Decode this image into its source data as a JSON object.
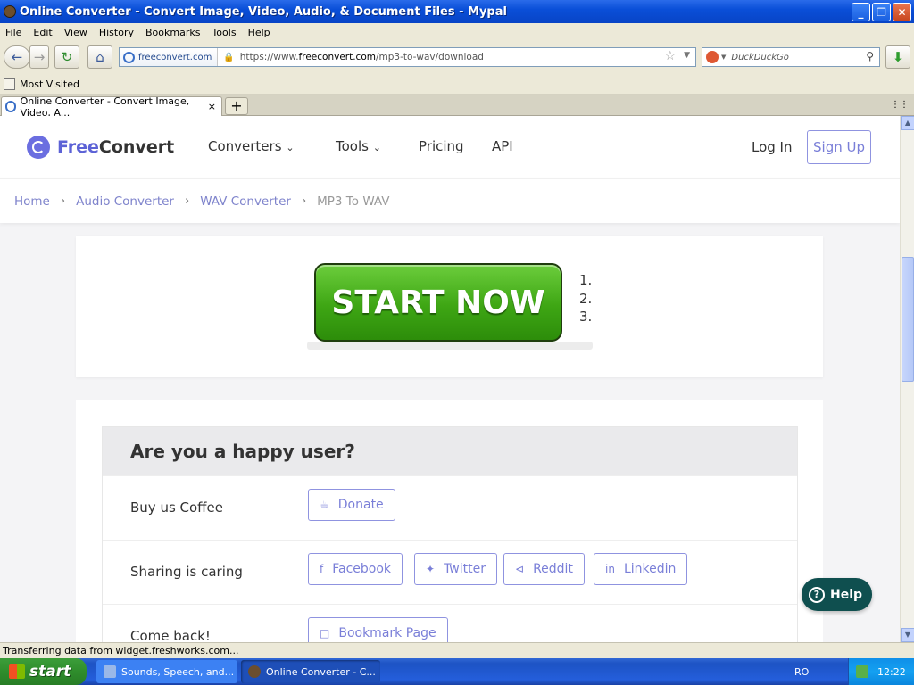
{
  "window": {
    "title": "Online Converter - Convert Image, Video, Audio, & Document Files - Mypal",
    "controls": {
      "minimize": "_",
      "maximize": "❐",
      "close": "✕"
    }
  },
  "menu": [
    "File",
    "Edit",
    "View",
    "History",
    "Bookmarks",
    "Tools",
    "Help"
  ],
  "nav": {
    "site_identity": "freeconvert.com",
    "url_prefix": "https://www.",
    "url_domain": "freeconvert.com",
    "url_path": "/mp3-to-wav/download",
    "search_placeholder": "DuckDuckGo"
  },
  "bookmarks_bar": {
    "most_visited": "Most Visited"
  },
  "tabs": [
    {
      "label": "Online Converter - Convert Image, Video, A...",
      "close": "×"
    }
  ],
  "site": {
    "logo_free": "Free",
    "logo_convert": "Convert",
    "nav_items": [
      "Converters",
      "Tools",
      "Pricing",
      "API"
    ],
    "login": "Log In",
    "signup": "Sign Up",
    "breadcrumb": [
      "Home",
      "Audio Converter",
      "WAV Converter",
      "MP3 To WAV"
    ],
    "start_button": "START NOW",
    "numbered_list": [
      "1.",
      "2.",
      "3."
    ],
    "happy_title": "Are you a happy user?",
    "rows": [
      {
        "label": "Buy us Coffee",
        "buttons": [
          "Donate"
        ]
      },
      {
        "label": "Sharing is caring",
        "buttons": [
          "Facebook",
          "Twitter",
          "Reddit",
          "Linkedin"
        ]
      },
      {
        "label": "Come back!",
        "buttons": [
          "Bookmark Page"
        ]
      }
    ],
    "help": "Help"
  },
  "status": "Transferring data from widget.freshworks.com...",
  "taskbar": {
    "start": "start",
    "tasks": [
      "Sounds, Speech, and...",
      "Online Converter - C..."
    ],
    "language": "RO",
    "clock": "12:22"
  }
}
